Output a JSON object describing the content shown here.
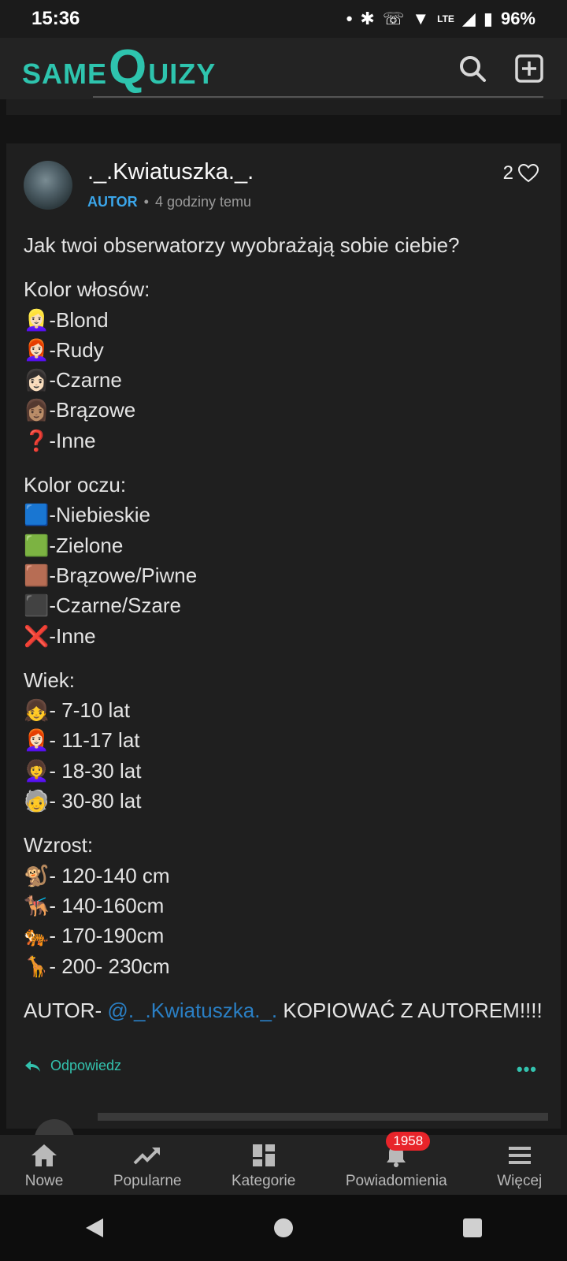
{
  "status": {
    "time": "15:36",
    "battery": "96%",
    "network": "LTE"
  },
  "app": {
    "logo_same": "SAME",
    "logo_q": "Q",
    "logo_uizy": "UIZY"
  },
  "post": {
    "author": "._.Kwiatuszka._.",
    "badge": "AUTOR",
    "time": "4 godziny temu",
    "likes": "2",
    "question": "Jak twoi obserwatorzy wyobrażają sobie ciebie?",
    "hair_title": "Kolor włosów:",
    "hair": [
      "👱🏻‍♀️-Blond",
      "👩🏻‍🦰-Rudy",
      "👩🏻-Czarne",
      "👩🏽-Brązowe",
      "❓-Inne"
    ],
    "eyes_title": "Kolor oczu:",
    "eyes": [
      "🟦-Niebieskie",
      "🟩-Zielone",
      "🟫-Brązowe/Piwne",
      "⬛-Czarne/Szare",
      "❌-Inne"
    ],
    "age_title": "Wiek:",
    "age": [
      "👧- 7-10 lat",
      "👩🏻‍🦰- 11-17 lat",
      "👩‍🦱- 18-30 lat",
      "🧓- 30-80 lat"
    ],
    "height_title": "Wzrost:",
    "height": [
      "🐒- 120-140 cm",
      "🐕‍🦺- 140-160cm",
      "🐅- 170-190cm",
      "🦒- 200- 230cm"
    ],
    "footer_pre": "AUTOR- ",
    "footer_mention": "@._.Kwiatuszka._.",
    "footer_post": " KOPIOWAĆ Z AUTOREM!!!!",
    "reply_label": "Odpowiedz",
    "more_label": "•••"
  },
  "tabs": [
    {
      "label": "Nowe",
      "icon": "home-icon"
    },
    {
      "label": "Popularne",
      "icon": "trending-icon"
    },
    {
      "label": "Kategorie",
      "icon": "grid-icon"
    },
    {
      "label": "Powiadomienia",
      "icon": "bell-icon",
      "badge": "1958"
    },
    {
      "label": "Więcej",
      "icon": "menu-icon"
    }
  ]
}
